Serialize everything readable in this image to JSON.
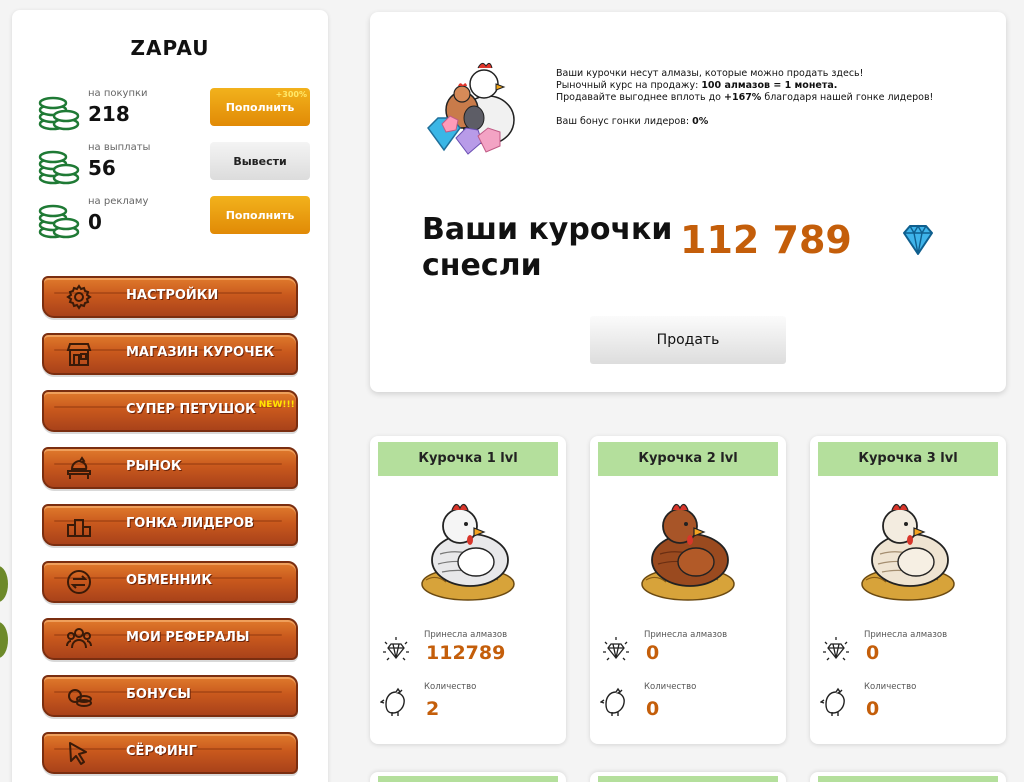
{
  "user": {
    "name": "ZAPAU"
  },
  "balances": [
    {
      "caption": "на покупки",
      "value": "218",
      "button": "Пополнить",
      "badge": "+300%",
      "style": "orange"
    },
    {
      "caption": "на выплаты",
      "value": "56",
      "button": "Вывести",
      "badge": "",
      "style": "gray"
    },
    {
      "caption": "на рекламу",
      "value": "0",
      "button": "Пополнить",
      "badge": "",
      "style": "orange"
    }
  ],
  "menu": [
    {
      "label": "НАСТРОЙКИ",
      "icon": "gear-icon",
      "new": ""
    },
    {
      "label": "МАГАЗИН КУРОЧЕК",
      "icon": "shop-icon",
      "new": ""
    },
    {
      "label": "СУПЕР ПЕТУШОК",
      "icon": "",
      "new": "NEW!!!"
    },
    {
      "label": "РЫНОК",
      "icon": "market-hen-icon",
      "new": ""
    },
    {
      "label": "ГОНКА ЛИДЕРОВ",
      "icon": "podium-icon",
      "new": ""
    },
    {
      "label": "ОБМЕННИК",
      "icon": "exchange-icon",
      "new": ""
    },
    {
      "label": "МОИ РЕФЕРАЛЫ",
      "icon": "referrals-icon",
      "new": ""
    },
    {
      "label": "БОНУСЫ",
      "icon": "coins-icon",
      "new": ""
    },
    {
      "label": "СЁРФИНГ",
      "icon": "cursor-icon",
      "new": ""
    }
  ],
  "info": {
    "line1": "Ваши курочки несут алмазы, которые можно продать здесь!",
    "line2_prefix": "Рыночный курс на продажу: ",
    "line2_bold": "100 алмазов = 1 монета.",
    "line3_prefix": "Продавайте выгоднее вплоть до ",
    "line3_bold": "+167%",
    "line3_suffix": " благодаря нашей гонке лидеров!",
    "line4_prefix": "Ваш бонус гонки лидеров: ",
    "line4_bold": "0%",
    "laid_title_1": "Ваши курочки",
    "laid_title_2": "снесли",
    "laid_value": "112 789",
    "sell_button": "Продать"
  },
  "hens": [
    {
      "title": "Курочка 1 lvl",
      "diamonds_caption": "Принесла алмазов",
      "diamonds": "112789",
      "count_caption": "Количество",
      "count": "2",
      "color": "#e8e8ea"
    },
    {
      "title": "Курочка 2 lvl",
      "diamonds_caption": "Принесла алмазов",
      "diamonds": "0",
      "count_caption": "Количество",
      "count": "0",
      "color": "#9a4a1f"
    },
    {
      "title": "Курочка 3 lvl",
      "diamonds_caption": "Принесла алмазов",
      "diamonds": "0",
      "count_caption": "Количество",
      "count": "0",
      "color": "#efe4d2"
    }
  ],
  "colors": {
    "accent": "#c45e0a",
    "card_header": "#b4df9c",
    "wood": "#c9591d",
    "button_orange": "#e89a10"
  }
}
